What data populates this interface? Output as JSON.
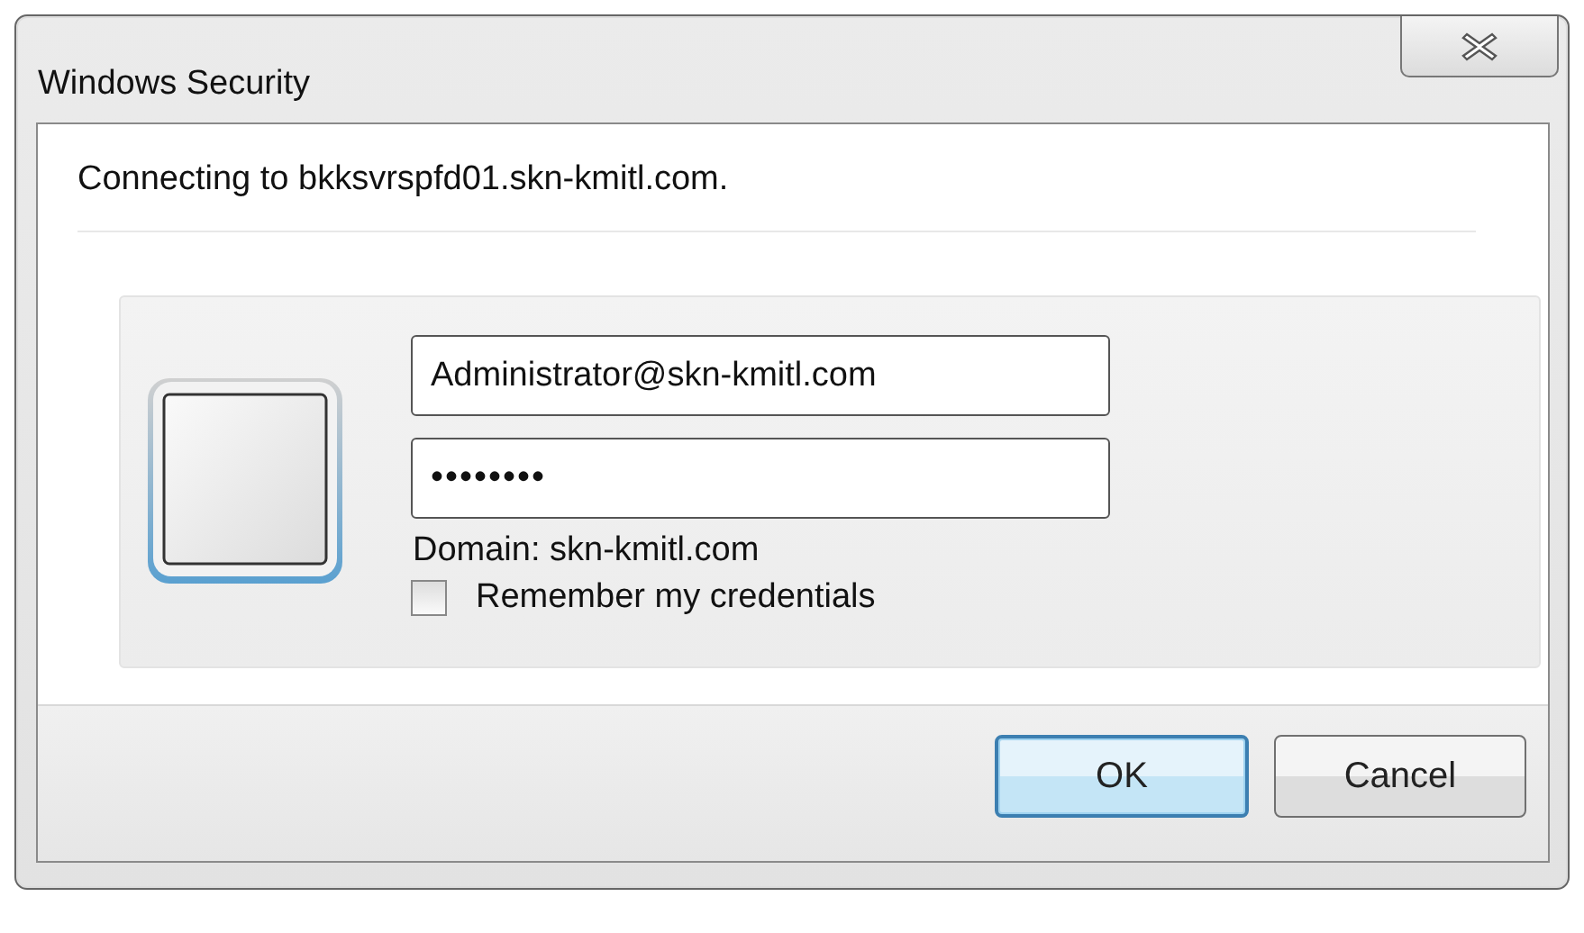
{
  "window": {
    "title": "Windows Security"
  },
  "message": "Connecting to bkksvrspfd01.skn-kmitl.com.",
  "credentials": {
    "username": "Administrator@skn-kmitl.com",
    "password": "••••••••",
    "domain": "Domain: skn-kmitl.com",
    "remember": {
      "label": "Remember my credentials",
      "checked": false
    }
  },
  "buttons": [
    {
      "label": "OK",
      "default": true
    },
    {
      "label": "Cancel",
      "default": false
    }
  ]
}
